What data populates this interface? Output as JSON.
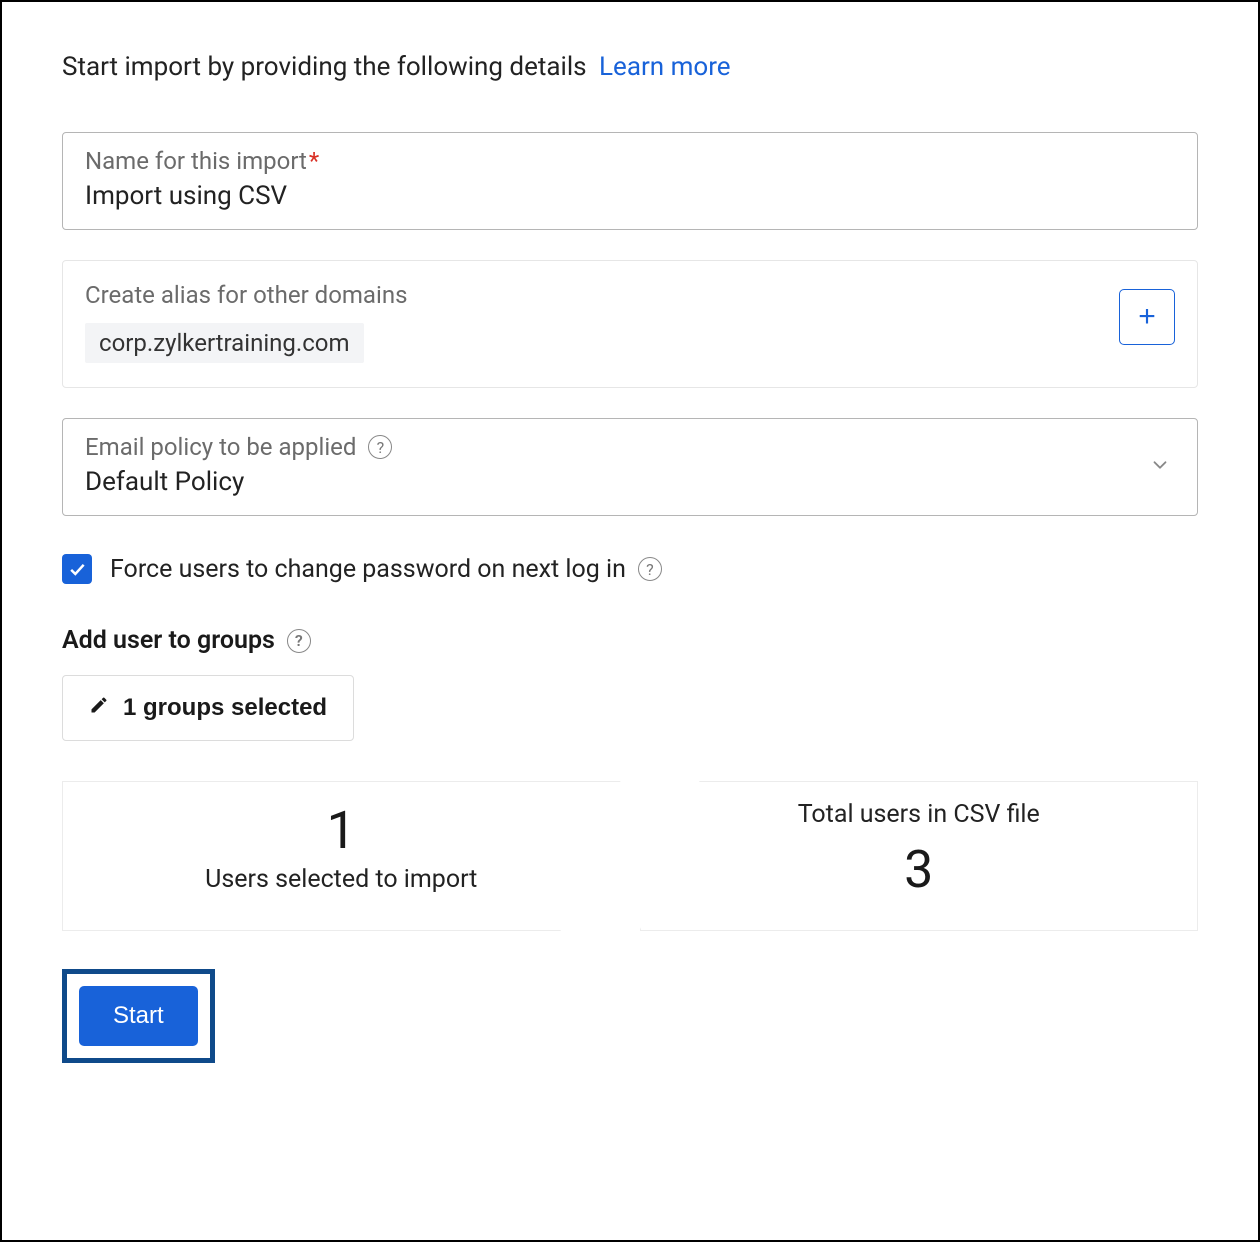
{
  "intro": {
    "text": "Start import by providing the following details",
    "learn_more": "Learn more"
  },
  "name_field": {
    "label": "Name for this import",
    "required": "*",
    "value": "Import using CSV"
  },
  "alias": {
    "label": "Create alias for other domains",
    "domain": "corp.zylkertraining.com",
    "add_symbol": "+"
  },
  "policy": {
    "label": "Email policy to be applied",
    "value": "Default Policy"
  },
  "force_pw": {
    "checked": true,
    "label": "Force users to change password on next log in"
  },
  "groups": {
    "section_label": "Add user to groups",
    "button_label": "1 groups selected"
  },
  "stats": {
    "selected_count": "1",
    "selected_label": "Users selected to import",
    "total_label": "Total users in CSV file",
    "total_count": "3"
  },
  "start_label": "Start",
  "help_glyph": "?"
}
